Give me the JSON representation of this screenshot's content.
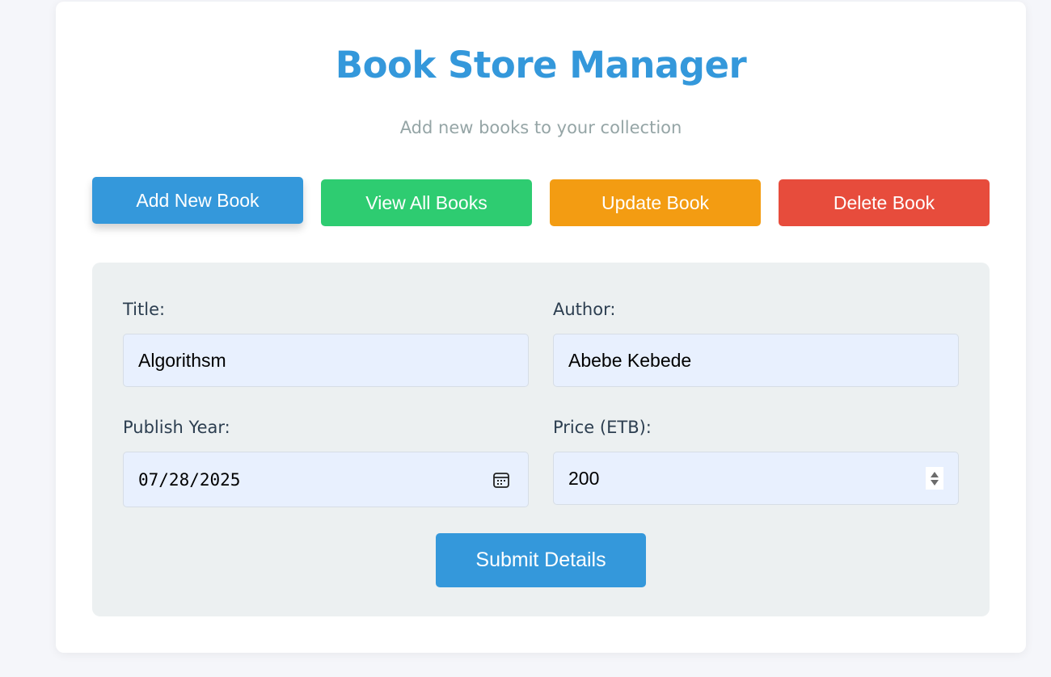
{
  "header": {
    "title": "Book Store Manager",
    "subtitle": "Add new books to your collection"
  },
  "nav": {
    "items": [
      {
        "label": "Add New Book",
        "color": "#3498db",
        "active": true
      },
      {
        "label": "View All Books",
        "color": "#2ecc71",
        "active": false
      },
      {
        "label": "Update Book",
        "color": "#f39c12",
        "active": false
      },
      {
        "label": "Delete Book",
        "color": "#e74c3c",
        "active": false
      }
    ]
  },
  "form": {
    "title_label": "Title:",
    "title_value": "Algorithsm",
    "author_label": "Author:",
    "author_value": "Abebe Kebede",
    "year_label": "Publish Year:",
    "year_value": "07/28/2025",
    "year_icon": "calendar-icon",
    "price_label": "Price (ETB):",
    "price_value": "200",
    "price_icon": "spinner-arrows-icon",
    "submit_label": "Submit Details"
  },
  "colors": {
    "accent": "#3498db",
    "background": "#f5f6fa",
    "panel": "#ecf0f1",
    "input_bg": "#e8f0fe"
  }
}
